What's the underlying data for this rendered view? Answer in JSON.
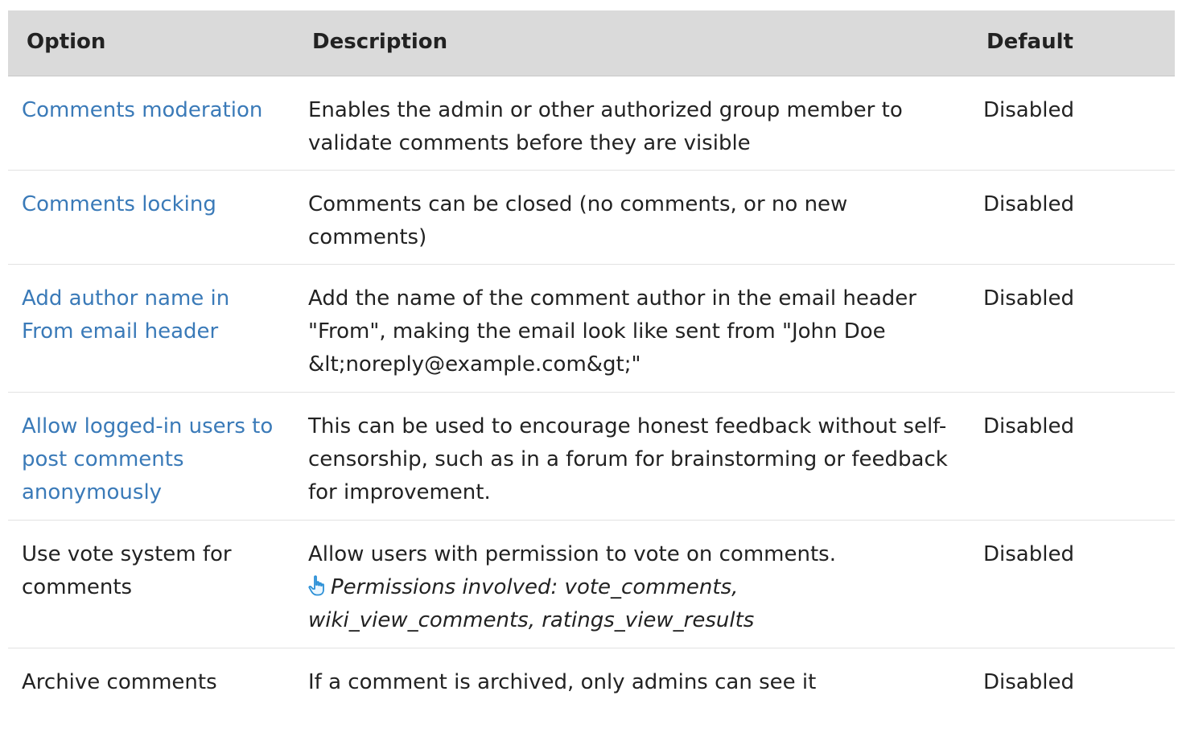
{
  "table": {
    "headers": {
      "option": "Option",
      "description": "Description",
      "default": "Default"
    },
    "rows": [
      {
        "option": "Comments moderation",
        "option_is_link": true,
        "description": "Enables the admin or other authorized group member to validate comments before they are visible",
        "default": "Disabled"
      },
      {
        "option": "Comments locking",
        "option_is_link": true,
        "description": "Comments can be closed (no comments, or no new comments)",
        "default": "Disabled"
      },
      {
        "option": "Add author name in From email header",
        "option_is_link": true,
        "description": "Add the name of the comment author in the email header \"From\", making the email look like sent from \"John Doe &lt;noreply@example.com&gt;\"",
        "default": "Disabled"
      },
      {
        "option": "Allow logged-in users to post comments anonymously",
        "option_is_link": true,
        "description": "This can be used to encourage honest feedback without self-censorship, such as in a forum for brainstorming or feedback for improvement.",
        "default": "Disabled"
      },
      {
        "option": "Use vote system for comments",
        "option_is_link": false,
        "description": "Allow users with permission to vote on comments.",
        "note": "Permissions involved: vote_comments, wiki_view_comments, ratings_view_results",
        "note_icon": "pointing-hand-icon",
        "default": "Disabled"
      },
      {
        "option": "Archive comments",
        "option_is_link": false,
        "description": "If a comment is archived, only admins can see it",
        "default": "Disabled"
      }
    ]
  },
  "colors": {
    "link": "#3a7ab8",
    "header_bg": "#dadada",
    "text": "#222222",
    "icon": "#2a8fd6"
  }
}
